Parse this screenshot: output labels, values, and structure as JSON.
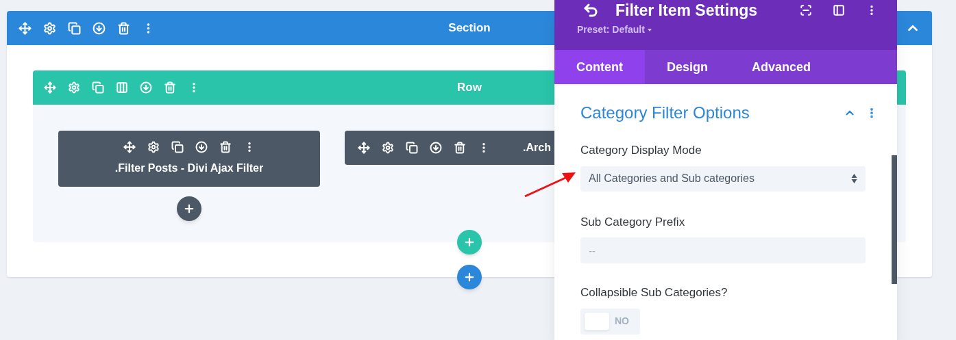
{
  "section": {
    "title": "Section"
  },
  "row": {
    "title": "Row"
  },
  "modules": [
    {
      "kind": "stacked",
      "title": ".Filter Posts - Divi Ajax Filter"
    },
    {
      "kind": "inline",
      "title": ".Arch"
    }
  ],
  "panel": {
    "title": "Filter Item Settings",
    "preset": "Preset: Default",
    "tabs": [
      {
        "label": "Content",
        "selected": true
      },
      {
        "label": "Design",
        "selected": false
      },
      {
        "label": "Advanced",
        "selected": false
      }
    ],
    "group": {
      "title": "Category Filter Options",
      "expanded": true
    },
    "fields": [
      {
        "kind": "select",
        "label": "Category Display Mode",
        "value": "All Categories and Sub categories"
      },
      {
        "kind": "text",
        "label": "Sub Category Prefix",
        "placeholder": "--"
      },
      {
        "kind": "toggle",
        "label": "Collapsible Sub Categories?",
        "on": false,
        "state_label": "NO"
      }
    ]
  }
}
